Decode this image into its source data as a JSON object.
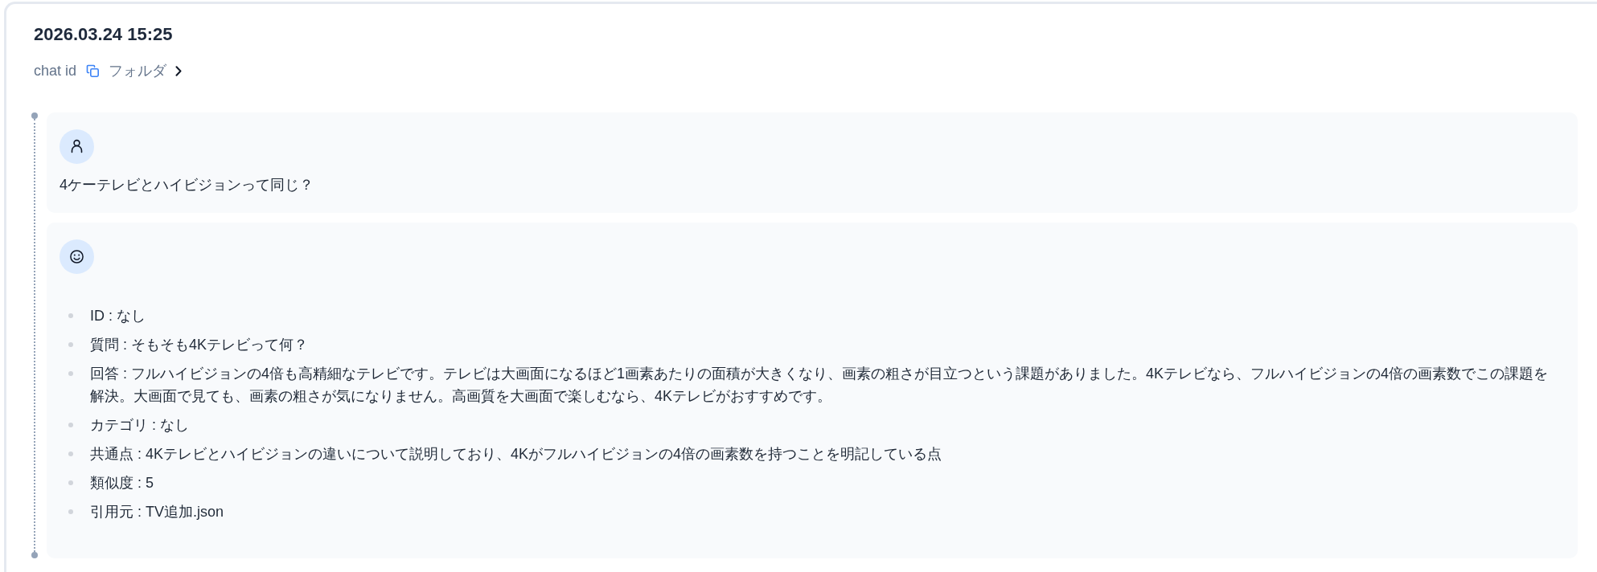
{
  "header": {
    "title": "2026.03.24 15:25",
    "chat_id_label": "chat id",
    "folder_link": "フォルダ"
  },
  "messages": [
    {
      "kind": "user",
      "text": "4ケーテレビとハイビジョンって同じ？"
    },
    {
      "kind": "assistant",
      "items": [
        "ID : なし",
        "質問 : そもそも4Kテレビって何？",
        "回答 : フルハイビジョンの4倍も高精細なテレビです。テレビは大画面になるほど1画素あたりの面積が大きくなり、画素の粗さが目立つという課題がありました。4Kテレビなら、フルハイビジョンの4倍の画素数でこの課題を解決。大画面で見ても、画素の粗さが気になりません。高画質を大画面で楽しむなら、4Kテレビがおすすめです。",
        "カテゴリ : なし",
        "共通点 : 4Kテレビとハイビジョンの違いについて説明しており、4Kがフルハイビジョンの4倍の画素数を持つことを明記している点",
        "類似度 : 5",
        "引用元 : TV追加.json"
      ]
    }
  ]
}
